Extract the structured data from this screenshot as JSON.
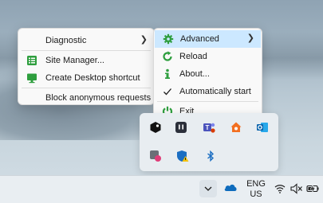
{
  "left_menu": {
    "items": [
      {
        "label": "Diagnostic",
        "icon": "none",
        "has_submenu": true
      },
      {
        "label": "Site Manager...",
        "icon": "list-icon"
      },
      {
        "label": "Create Desktop shortcut",
        "icon": "monitor-icon"
      },
      {
        "label": "Block anonymous requests",
        "icon": "none"
      }
    ]
  },
  "right_menu": {
    "items": [
      {
        "label": "Advanced",
        "icon": "gear-icon",
        "has_submenu": true,
        "highlighted": true
      },
      {
        "label": "Reload",
        "icon": "refresh-icon"
      },
      {
        "label": "About...",
        "icon": "info-icon"
      },
      {
        "label": "Automatically start",
        "icon": "checkmark-icon",
        "checked": true
      },
      {
        "label": "Exit",
        "icon": "power-icon"
      }
    ]
  },
  "tray_icons": [
    "cube-app-icon",
    "bracket-app-icon",
    "teams-icon",
    "home-app-icon",
    "outlook-icon",
    "snip-app-icon",
    "defender-warning-icon",
    "bluetooth-icon"
  ],
  "taskbar": {
    "lang_line1": "ENG",
    "lang_line2": "US"
  },
  "colors": {
    "accent_green": "#2e9e3e",
    "highlight": "#cce8ff"
  }
}
